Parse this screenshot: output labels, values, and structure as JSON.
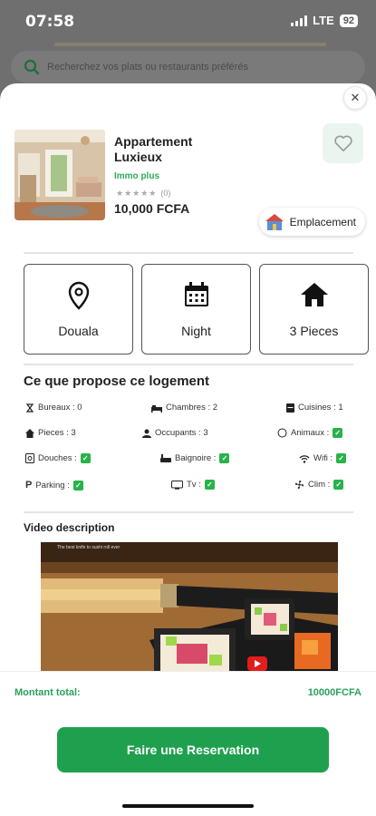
{
  "status_bar": {
    "time": "07:58",
    "network": "LTE",
    "battery": "92"
  },
  "search": {
    "placeholder": "Recherchez vos plats ou restaurants préférés"
  },
  "property": {
    "name": "Appartement Luxieux",
    "brand": "Immo plus",
    "stars": "★★★★★",
    "rating_count": "(0)",
    "price": "10,000 FCFA",
    "location_button": "Emplacement"
  },
  "info_cards": [
    {
      "label": "Douala",
      "icon": "map-pin-icon"
    },
    {
      "label": "Night",
      "icon": "calendar-icon"
    },
    {
      "label": "3 Pieces",
      "icon": "house-icon"
    }
  ],
  "amenities_title": "Ce que propose ce logement",
  "amenities": [
    {
      "label": "Bureaux : 0",
      "icon": "desk-icon",
      "checked": false
    },
    {
      "label": "Chambres : 2",
      "icon": "bed-icon",
      "checked": false
    },
    {
      "label": "Cuisines : 1",
      "icon": "kitchen-icon",
      "checked": false
    },
    {
      "label": "Pieces : 3",
      "icon": "house-icon",
      "checked": false
    },
    {
      "label": "Occupants : 3",
      "icon": "person-icon",
      "checked": false
    },
    {
      "label": "Animaux :",
      "icon": "paw-icon",
      "checked": true
    },
    {
      "label": "Douches :",
      "icon": "shower-icon",
      "checked": true
    },
    {
      "label": "Baignoire :",
      "icon": "bathtub-icon",
      "checked": true
    },
    {
      "label": "Wifi :",
      "icon": "wifi-icon",
      "checked": true
    },
    {
      "label": "Parking :",
      "icon": "parking-icon",
      "checked": true
    },
    {
      "label": "Tv :",
      "icon": "tv-icon",
      "checked": true
    },
    {
      "label": "Clim :",
      "icon": "fan-icon",
      "checked": true
    }
  ],
  "video": {
    "title": "Video description",
    "caption": "The best knife to sushi roll ever"
  },
  "footer": {
    "total_label": "Montant total:",
    "total_value": "10000FCFA",
    "button_label": "Faire une Reservation"
  },
  "colors": {
    "accent": "#1fa04e",
    "accent_text": "#2aa05a",
    "checkbox": "#28b24a"
  }
}
